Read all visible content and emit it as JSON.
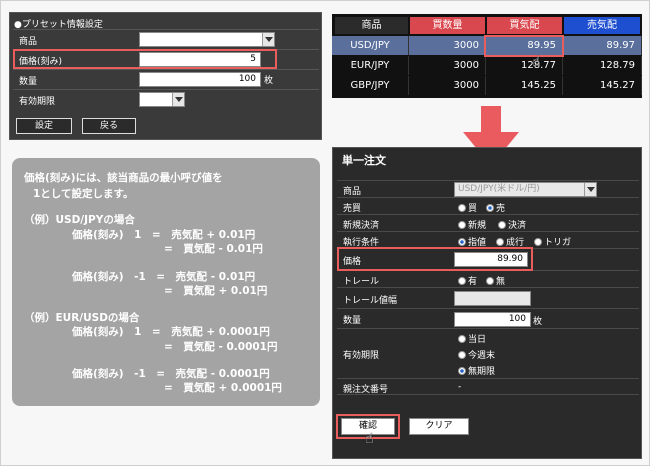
{
  "preset": {
    "title": "●プリセット情報設定",
    "rows": [
      {
        "label": "商品",
        "value": ""
      },
      {
        "label": "価格(刻み)",
        "value": "5"
      },
      {
        "label": "数量",
        "value": "100",
        "unit": "枚"
      },
      {
        "label": "有効期限",
        "value": ""
      }
    ],
    "buttons": {
      "set": "設定",
      "back": "戻る"
    }
  },
  "rates": {
    "headers": [
      "商品",
      "買数量",
      "買気配",
      "売気配"
    ],
    "rows": [
      {
        "symbol": "USD/JPY",
        "qty": "3000",
        "bid": "89.95",
        "ask": "89.97"
      },
      {
        "symbol": "EUR/JPY",
        "qty": "3000",
        "bid": "128.77",
        "ask": "128.79"
      },
      {
        "symbol": "GBP/JPY",
        "qty": "3000",
        "bid": "145.25",
        "ask": "145.27"
      }
    ],
    "colors": {
      "head_dark": "#2b2b2b",
      "head_red": "#d9484f",
      "head_blue": "#1f4fd1",
      "selected_row": "#5a6f9c"
    }
  },
  "info": {
    "lines": [
      "価格(刻み)には、該当商品の最小呼び値を",
      "1として設定します。",
      "（例）USD/JPYの場合",
      "価格(刻み)　1　=　売気配 + 0.01円",
      "=　買気配 - 0.01円",
      "価格(刻み)　-1　=　売気配 - 0.01円",
      "=　買気配 + 0.01円",
      "（例）EUR/USDの場合",
      "価格(刻み)　1　=　売気配 + 0.0001円",
      "=　買気配 - 0.0001円",
      "価格(刻み)　-1　=　売気配 - 0.0001円",
      "=　買気配 + 0.0001円"
    ]
  },
  "order": {
    "title": "単一注文",
    "product_label": "商品",
    "product_value": "USD/JPY(米ドル/円)",
    "side_label": "売買",
    "side_buy": "買",
    "side_sell": "売",
    "close_label": "新規決済",
    "close_new": "新規",
    "close_settle": "決済",
    "cond_label": "執行条件",
    "cond_limit": "指値",
    "cond_market": "成行",
    "cond_trigger": "トリガ",
    "price_label": "価格",
    "price_value": "89.90",
    "trail_label": "トレール",
    "trail_yes": "有",
    "trail_no": "無",
    "trail_width_label": "トレール値幅",
    "qty_label": "数量",
    "qty_value": "100",
    "qty_unit": "枚",
    "expiry_label": "有効期限",
    "expiry_today": "当日",
    "expiry_week": "今週末",
    "expiry_none": "無期限",
    "parent_label": "親注文番号",
    "parent_value": "-",
    "confirm_label": "確認",
    "clear_label": "クリア"
  },
  "colors": {
    "highlight": "#ea5d5d",
    "arrow": "#e95b5f",
    "info_bg": "#a4a4a4"
  }
}
